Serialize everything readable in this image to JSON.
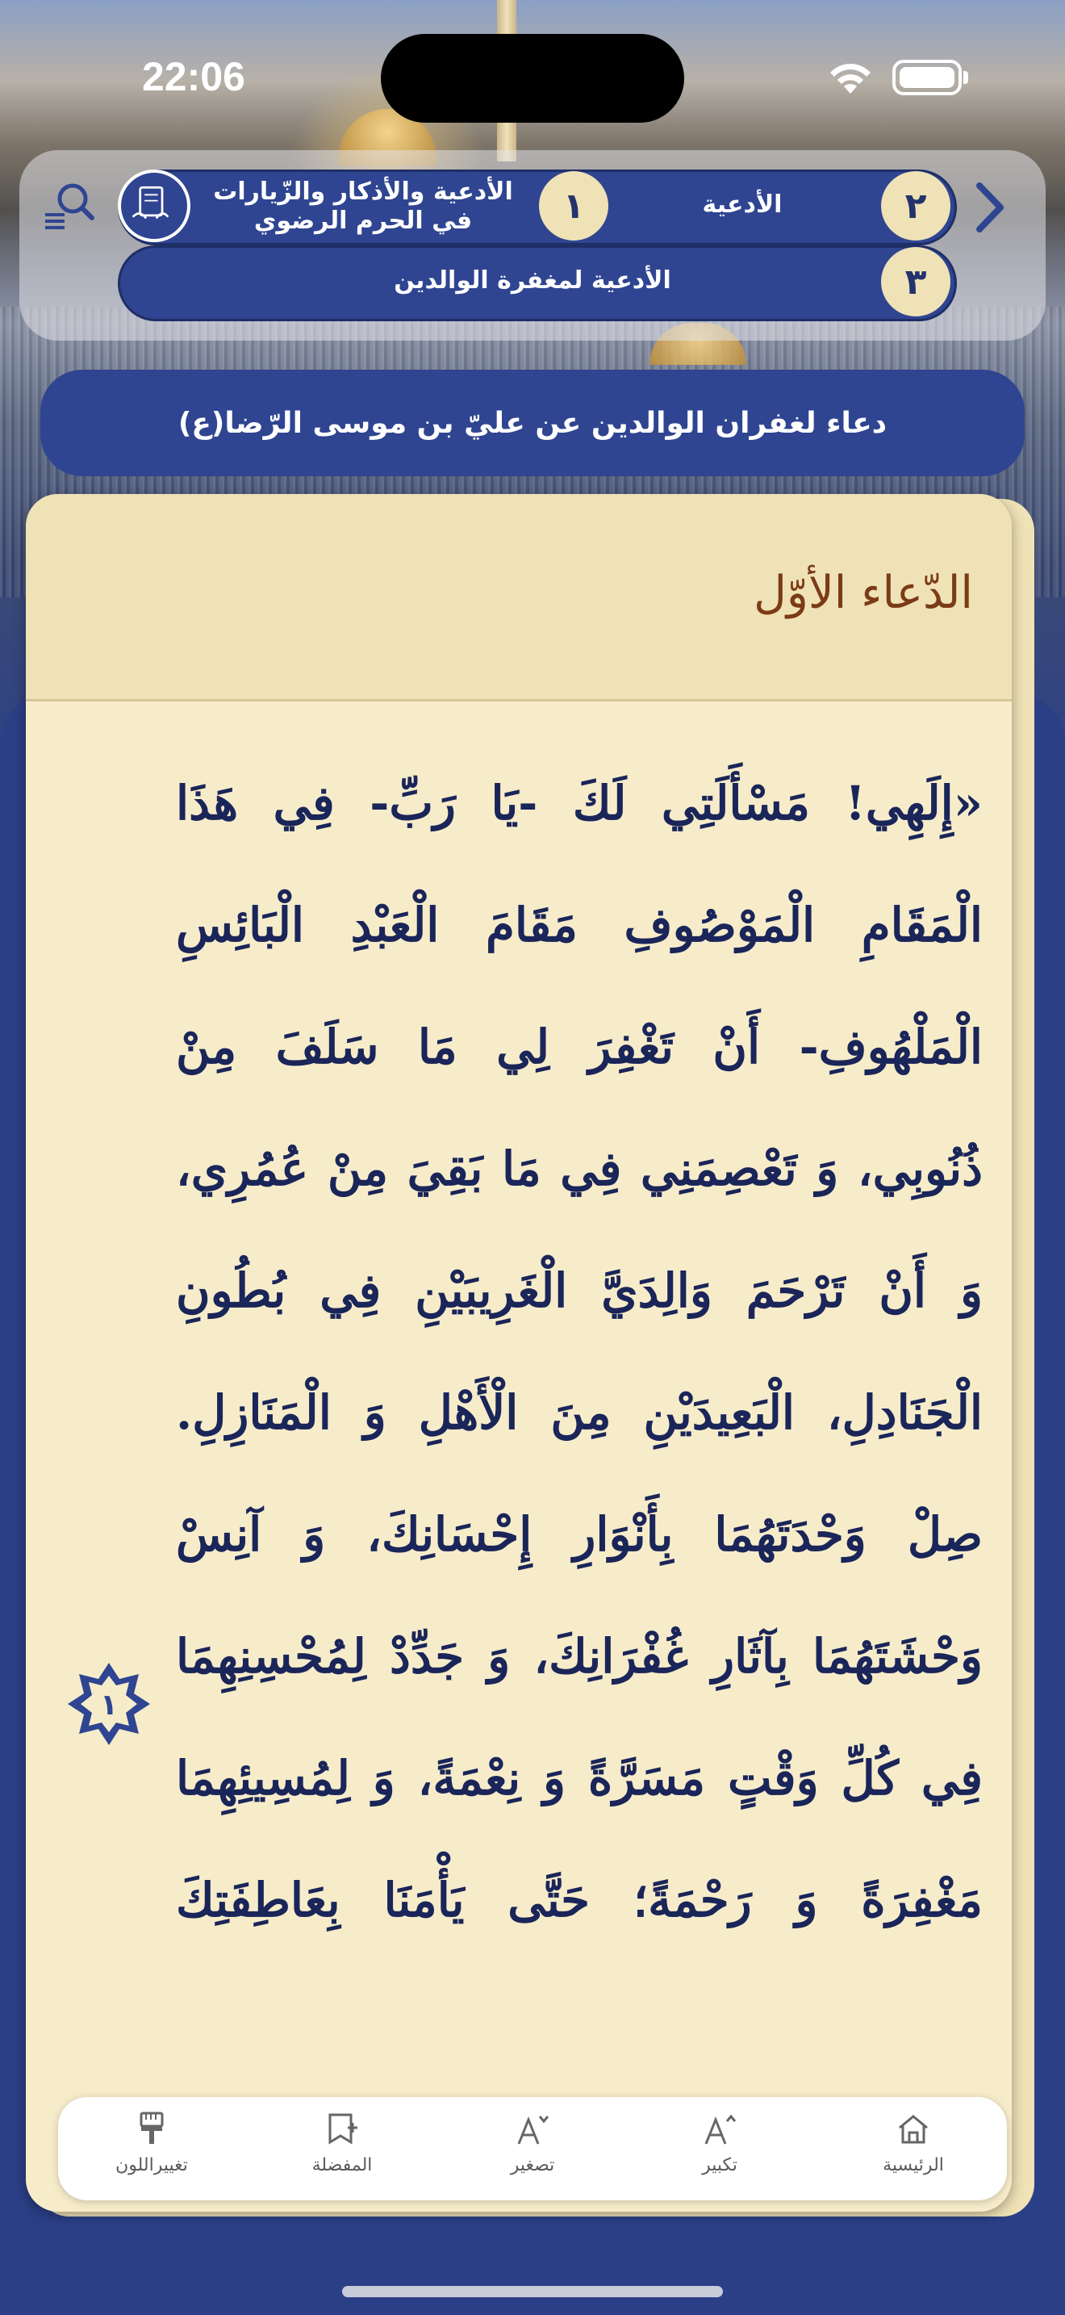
{
  "status_bar": {
    "time": "22:06"
  },
  "breadcrumb": {
    "level1": {
      "number": "١",
      "label": "الأدعية والأذكار والزّيارات في الحرم الرضوي"
    },
    "level2": {
      "number": "٢",
      "label": "الأدعية"
    },
    "level3": {
      "number": "٣",
      "label": "الأدعية لمغفرة الوالدين"
    }
  },
  "banner": {
    "title": "دعاء لغفران الوالدين عن عليّ بن موسى الرّضا(ع)"
  },
  "card": {
    "title": "الدّعاء الأوّل",
    "verse_number": "١",
    "text": "«إِلَهِي! مَسْأَلَتِي لَكَ -يَا رَبِّ- فِي هَذَا الْمَقَامِ الْمَوْصُوفِ مَقَامَ الْعَبْدِ الْبَائِسِ الْمَلْهُوفِ- أَنْ تَغْفِرَ لِي مَا سَلَفَ مِنْ ذُنُوبِي، وَ تَعْصِمَنِي فِي مَا بَقِيَ مِنْ عُمُرِي، وَ أَنْ تَرْحَمَ وَالِدَيَّ الْغَرِيبَيْنِ فِي بُطُونِ الْجَنَادِلِ، الْبَعِيدَيْنِ مِنَ الْأَهْلِ وَ الْمَنَازِلِ. صِلْ وَحْدَتَهُمَا بِأَنْوَارِ إِحْسَانِكَ، وَ آنِسْ وَحْشَتَهُمَا بِآثَارِ غُفْرَانِكَ، وَ جَدِّدْ لِمُحْسِنِهِمَا فِي كُلِّ وَقْتٍ مَسَرَّةً وَ نِعْمَةً، وَ لِمُسِيئِهِمَا مَغْفِرَةً وَ رَحْمَةً؛ حَتَّى يَأْمَنَا بِعَاطِفَتِكَ"
  },
  "toolbar": {
    "home": "الرئيسية",
    "zoom_in": "تكبير",
    "zoom_out": "تصغير",
    "favorite": "المفضلة",
    "change_color": "تغييراللون"
  },
  "colors": {
    "navy": "#2f4591",
    "cream": "#f7ecca",
    "title_brown": "#7b3b16"
  }
}
